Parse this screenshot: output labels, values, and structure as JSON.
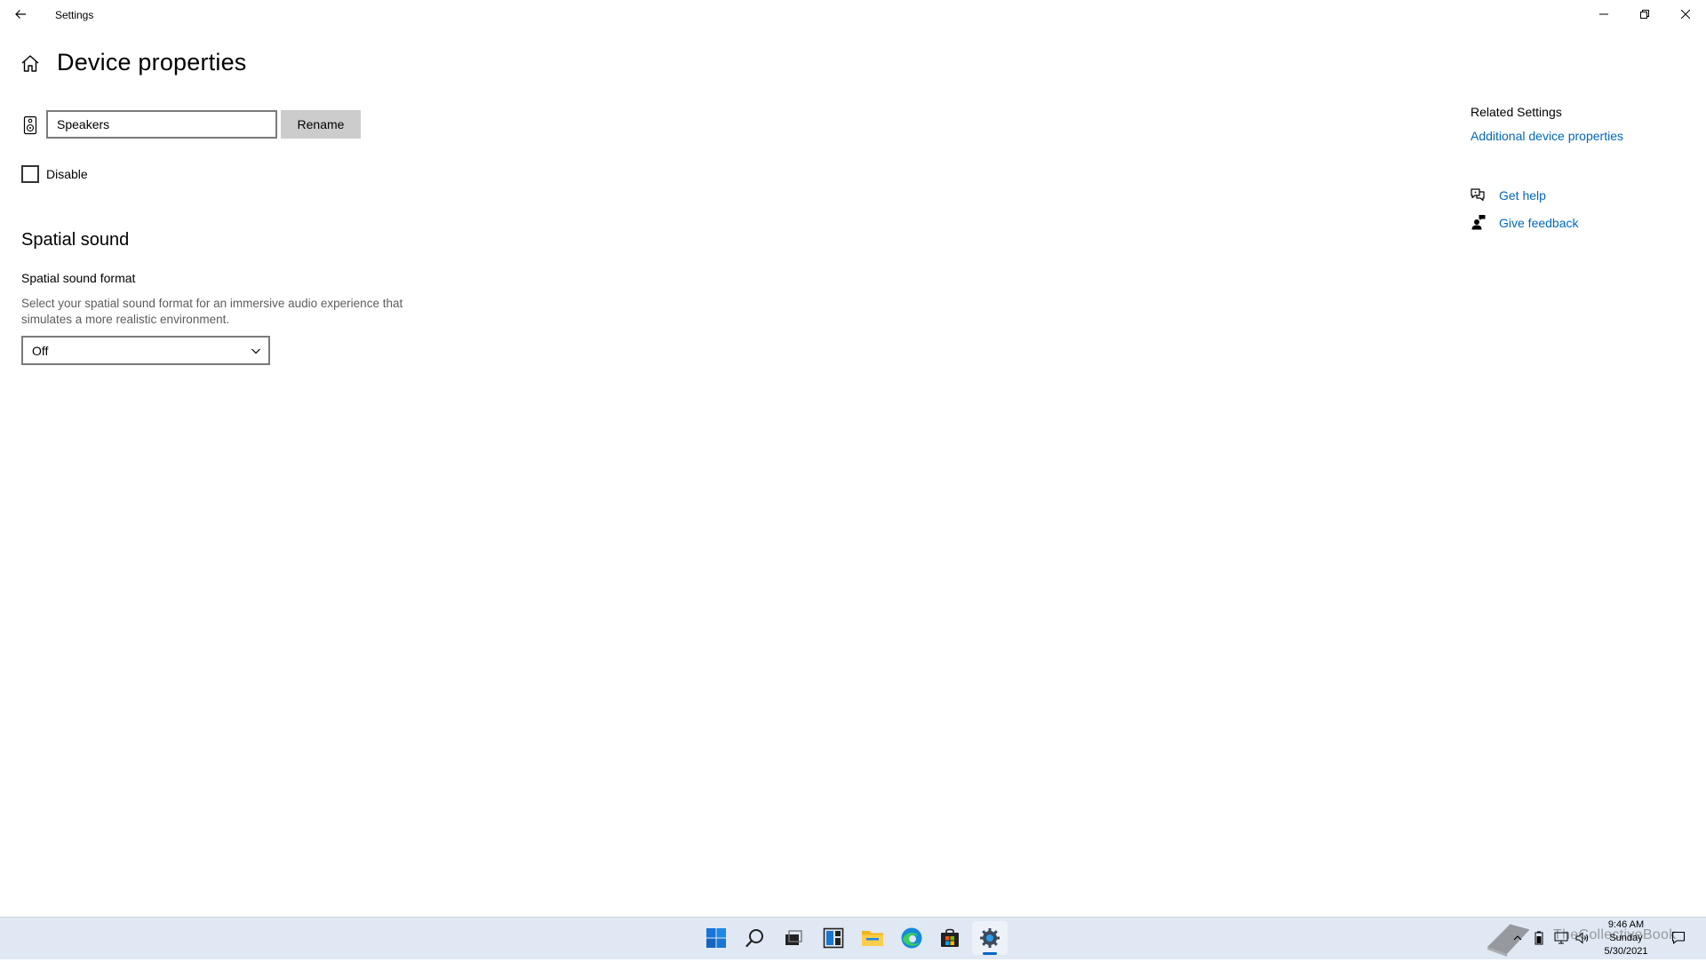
{
  "window": {
    "title": "Settings"
  },
  "header": {
    "title": "Device properties"
  },
  "device": {
    "name_value": "Speakers",
    "rename_label": "Rename",
    "disable_label": "Disable",
    "disable_checked": false
  },
  "spatial": {
    "section_title": "Spatial sound",
    "format_label": "Spatial sound format",
    "description": "Select your spatial sound format for an immersive audio experience that simulates a more realistic environment.",
    "selected": "Off"
  },
  "related": {
    "heading": "Related Settings",
    "additional_link": "Additional device properties",
    "get_help": "Get help",
    "give_feedback": "Give feedback"
  },
  "taskbar": {
    "time": "9:46 AM",
    "day": "Sunday",
    "date": "5/30/2021",
    "watermark": "TheCollectiveBook"
  },
  "colors": {
    "accent": "#0067c0",
    "taskbar": "#dfe8f3",
    "button": "#cccccc"
  },
  "icons": {
    "back": "arrow-left-icon",
    "home": "home-icon",
    "speaker": "speaker-icon",
    "help": "chat-help-icon",
    "feedback": "person-feedback-icon"
  }
}
